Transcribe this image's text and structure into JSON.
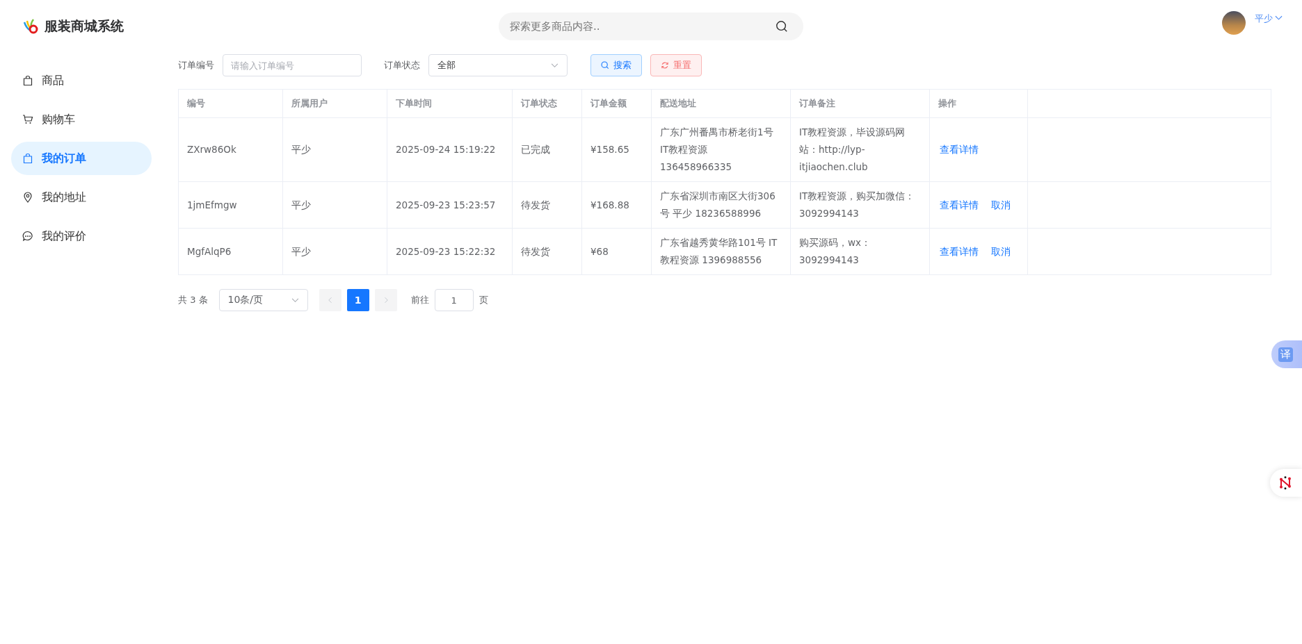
{
  "header": {
    "app_name": "服装商城系统",
    "search": {
      "placeholder": "探索更多商品内容.."
    },
    "user": {
      "name": "平少"
    }
  },
  "sidebar": {
    "items": [
      {
        "label": "商品",
        "selected": false
      },
      {
        "label": "购物车",
        "selected": false
      },
      {
        "label": "我的订单",
        "selected": true
      },
      {
        "label": "我的地址",
        "selected": false
      },
      {
        "label": "我的评价",
        "selected": false
      }
    ]
  },
  "filters": {
    "order_no": {
      "label": "订单编号",
      "placeholder": "请输入订单编号"
    },
    "status": {
      "label": "订单状态",
      "value": "全部"
    },
    "search_button": "搜索",
    "reset_button": "重置"
  },
  "table": {
    "columns": [
      "编号",
      "所属用户",
      "下单时间",
      "订单状态",
      "订单金额",
      "配送地址",
      "订单备注",
      "操作"
    ],
    "rows": [
      {
        "cells": [
          "ZXrw86Ok",
          "平少",
          "2025-09-24 15:19:22",
          "已完成",
          "¥158.65",
          "广东广州番禺市桥老街1号 IT教程资源 136458966335",
          "IT教程资源，毕设源码网站：http://lyp-itjiaochen.club"
        ],
        "actions": [
          "查看详情"
        ]
      },
      {
        "cells": [
          "1jmEfmgw",
          "平少",
          "2025-09-23 15:23:57",
          "待发货",
          "¥168.88",
          "广东省深圳市南区大街306号 平少 18236588996",
          "IT教程资源，购买加微信：3092994143"
        ],
        "actions": [
          "查看详情",
          "取消"
        ]
      },
      {
        "cells": [
          "MgfAlqP6",
          "平少",
          "2025-09-23 15:22:32",
          "待发货",
          "¥68",
          "广东省越秀黄华路101号 IT教程资源 1396988556",
          "购买源码，wx：3092994143"
        ],
        "actions": [
          "查看详情",
          "取消"
        ]
      }
    ]
  },
  "pagination": {
    "total": "共 3 条",
    "page_size": "10条/页",
    "pages": [
      {
        "label": "1",
        "selected": true
      }
    ],
    "goto_label": "前往",
    "goto_value": "1",
    "page_suffix": "页"
  },
  "floating": {
    "translate_label": "译"
  }
}
